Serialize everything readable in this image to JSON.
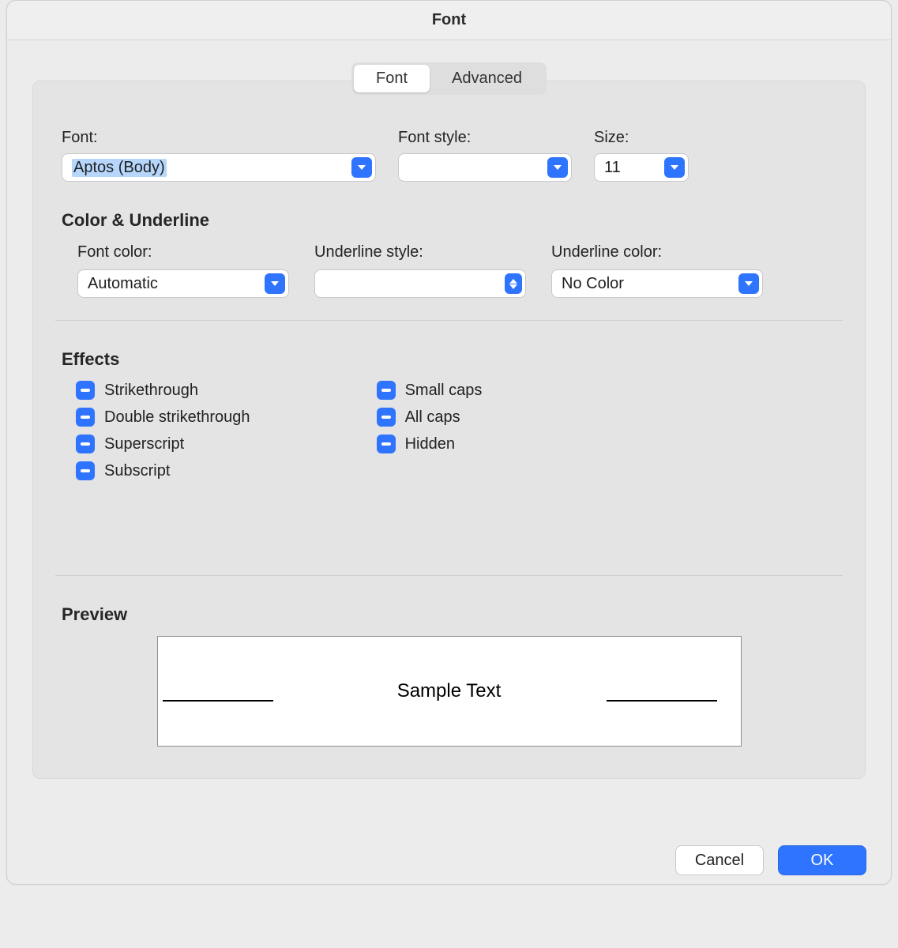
{
  "window": {
    "title": "Font"
  },
  "tabs": {
    "font": "Font",
    "advanced": "Advanced",
    "active": "font"
  },
  "labels": {
    "font": "Font:",
    "font_style": "Font style:",
    "size": "Size:",
    "color_underline": "Color & Underline",
    "font_color": "Font color:",
    "underline_style": "Underline style:",
    "underline_color": "Underline color:",
    "effects": "Effects",
    "preview": "Preview"
  },
  "values": {
    "font": "Aptos (Body)",
    "font_style": "",
    "size": "11",
    "font_color": "Automatic",
    "underline_style": "",
    "underline_color": "No Color"
  },
  "effects": {
    "left": [
      "Strikethrough",
      "Double strikethrough",
      "Superscript",
      "Subscript"
    ],
    "right": [
      "Small caps",
      "All caps",
      "Hidden"
    ]
  },
  "preview": {
    "text": "Sample Text"
  },
  "buttons": {
    "cancel": "Cancel",
    "ok": "OK"
  }
}
